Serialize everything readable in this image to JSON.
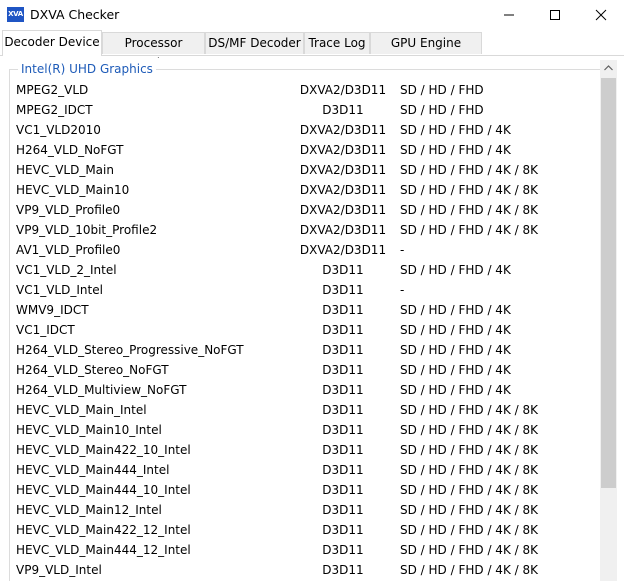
{
  "window": {
    "icon_text": "XVA",
    "title": "DXVA Checker"
  },
  "tabs": [
    {
      "label": "Decoder Device"
    },
    {
      "label": "Processor Device"
    },
    {
      "label": "DS/MF Decoder"
    },
    {
      "label": "Trace Log"
    },
    {
      "label": "GPU Engine Usage"
    }
  ],
  "group": {
    "title": "Intel(R) UHD Graphics"
  },
  "rows": [
    {
      "name": "MPEG2_VLD",
      "api": "DXVA2/D3D11",
      "res": "SD / HD / FHD"
    },
    {
      "name": "MPEG2_IDCT",
      "api": "D3D11",
      "res": "SD / HD / FHD"
    },
    {
      "name": "VC1_VLD2010",
      "api": "DXVA2/D3D11",
      "res": "SD / HD / FHD / 4K"
    },
    {
      "name": "H264_VLD_NoFGT",
      "api": "DXVA2/D3D11",
      "res": "SD / HD / FHD / 4K"
    },
    {
      "name": "HEVC_VLD_Main",
      "api": "DXVA2/D3D11",
      "res": "SD / HD / FHD / 4K / 8K"
    },
    {
      "name": "HEVC_VLD_Main10",
      "api": "DXVA2/D3D11",
      "res": "SD / HD / FHD / 4K / 8K"
    },
    {
      "name": "VP9_VLD_Profile0",
      "api": "DXVA2/D3D11",
      "res": "SD / HD / FHD / 4K / 8K"
    },
    {
      "name": "VP9_VLD_10bit_Profile2",
      "api": "DXVA2/D3D11",
      "res": "SD / HD / FHD / 4K / 8K"
    },
    {
      "name": "AV1_VLD_Profile0",
      "api": "DXVA2/D3D11",
      "res": "-"
    },
    {
      "name": "VC1_VLD_2_Intel",
      "api": "D3D11",
      "res": "SD / HD / FHD / 4K"
    },
    {
      "name": "VC1_VLD_Intel",
      "api": "D3D11",
      "res": "-"
    },
    {
      "name": "WMV9_IDCT",
      "api": "D3D11",
      "res": "SD / HD / FHD / 4K"
    },
    {
      "name": "VC1_IDCT",
      "api": "D3D11",
      "res": "SD / HD / FHD / 4K"
    },
    {
      "name": "H264_VLD_Stereo_Progressive_NoFGT",
      "api": "D3D11",
      "res": "SD / HD / FHD / 4K"
    },
    {
      "name": "H264_VLD_Stereo_NoFGT",
      "api": "D3D11",
      "res": "SD / HD / FHD / 4K"
    },
    {
      "name": "H264_VLD_Multiview_NoFGT",
      "api": "D3D11",
      "res": "SD / HD / FHD / 4K"
    },
    {
      "name": "HEVC_VLD_Main_Intel",
      "api": "D3D11",
      "res": "SD / HD / FHD / 4K / 8K"
    },
    {
      "name": "HEVC_VLD_Main10_Intel",
      "api": "D3D11",
      "res": "SD / HD / FHD / 4K / 8K"
    },
    {
      "name": "HEVC_VLD_Main422_10_Intel",
      "api": "D3D11",
      "res": "SD / HD / FHD / 4K / 8K"
    },
    {
      "name": "HEVC_VLD_Main444_Intel",
      "api": "D3D11",
      "res": "SD / HD / FHD / 4K / 8K"
    },
    {
      "name": "HEVC_VLD_Main444_10_Intel",
      "api": "D3D11",
      "res": "SD / HD / FHD / 4K / 8K"
    },
    {
      "name": "HEVC_VLD_Main12_Intel",
      "api": "D3D11",
      "res": "SD / HD / FHD / 4K / 8K"
    },
    {
      "name": "HEVC_VLD_Main422_12_Intel",
      "api": "D3D11",
      "res": "SD / HD / FHD / 4K / 8K"
    },
    {
      "name": "HEVC_VLD_Main444_12_Intel",
      "api": "D3D11",
      "res": "SD / HD / FHD / 4K / 8K"
    },
    {
      "name": "VP9_VLD_Intel",
      "api": "D3D11",
      "res": "SD / HD / FHD / 4K / 8K"
    }
  ],
  "icons": {
    "minimize": "minimize-icon",
    "maximize": "maximize-icon",
    "close": "close-icon",
    "scroll_up": "chevron-up-icon"
  },
  "colors": {
    "group_title": "#1e5bb8",
    "app_icon": "#1f55c4"
  }
}
